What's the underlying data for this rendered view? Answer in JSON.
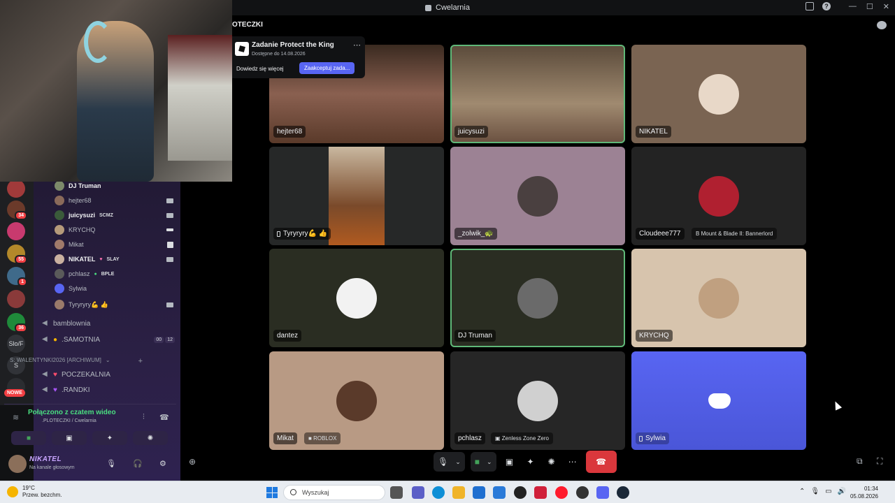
{
  "window": {
    "title": "Cwelarnia"
  },
  "channel_header": "OTECZKI",
  "quest": {
    "title": "Zadanie Protect the King",
    "subtitle": "Dostępne do 14.08.2026",
    "more_label": "Dowiedz się więcej",
    "accept_label": "Zaakceptuj zada..."
  },
  "members": [
    {
      "name": "DJ Truman",
      "bold": true,
      "tag": ""
    },
    {
      "name": "hejter68",
      "bold": false,
      "tag": ""
    },
    {
      "name": "juicysuzi",
      "bold": true,
      "tag": "SCMZ"
    },
    {
      "name": "KRYCHQ",
      "bold": false,
      "tag": ""
    },
    {
      "name": "Mikat",
      "bold": false,
      "tag": ""
    },
    {
      "name": "NIKATEL",
      "bold": true,
      "tag": "SLAY"
    },
    {
      "name": "pchlasz",
      "bold": false,
      "tag": "BPLE"
    },
    {
      "name": "Sylwia",
      "bold": false,
      "tag": ""
    },
    {
      "name": "Tyryryry💪 👍",
      "bold": false,
      "tag": ""
    }
  ],
  "channels": [
    {
      "name": "bamblownia"
    },
    {
      "name": ".SAMOTNIA",
      "counts": [
        "00",
        "12"
      ]
    }
  ],
  "category": {
    "name": "S: WALENTYNKI2026 [ARCHIWUM]"
  },
  "channels2": [
    {
      "name": "POCZEKALNIA"
    },
    {
      "name": ".RANDKI"
    }
  ],
  "servers": [
    {
      "badge": ""
    },
    {
      "badge": "34"
    },
    {
      "badge": ""
    },
    {
      "badge": "55"
    },
    {
      "badge": "1"
    },
    {
      "badge": ""
    },
    {
      "badge": "36"
    },
    {
      "label": "Slo/F"
    },
    {
      "label": "S"
    },
    {
      "label": "NOWE"
    }
  ],
  "voice": {
    "status": "Połączono z czatem wideo",
    "location": ".PLOTECZKI / Cwelarnia"
  },
  "user": {
    "name": "NIKATEL",
    "status": "Na kanale głosowym"
  },
  "tiles": [
    {
      "name": "hejter68",
      "activity": ""
    },
    {
      "name": "juicysuzi",
      "activity": ""
    },
    {
      "name": "NIKATEL",
      "activity": ""
    },
    {
      "name": "Tyryryry💪 👍",
      "activity": ""
    },
    {
      "name": "_zolwik_🐢",
      "activity": ""
    },
    {
      "name": "Cloudeee777",
      "activity": "Mount & Blade II: Bannerlord"
    },
    {
      "name": "dantez",
      "activity": ""
    },
    {
      "name": "DJ Truman",
      "activity": ""
    },
    {
      "name": "KRYCHQ",
      "activity": ""
    },
    {
      "name": "Mikat",
      "activity": "ROBLOX"
    },
    {
      "name": "pchlasz",
      "activity": "Zenless Zone Zero"
    },
    {
      "name": "Sylwia",
      "activity": ""
    }
  ],
  "taskbar": {
    "weather_temp": "19°C",
    "weather_desc": "Przew. bezchm.",
    "search_placeholder": "Wyszukaj",
    "time": "01:34",
    "date": "05.08.2026"
  },
  "colors": {
    "accent": "#5865f2",
    "selected_outline": "#5fb878",
    "disconnect": "#da373c",
    "sidebar": "#2b2045"
  }
}
